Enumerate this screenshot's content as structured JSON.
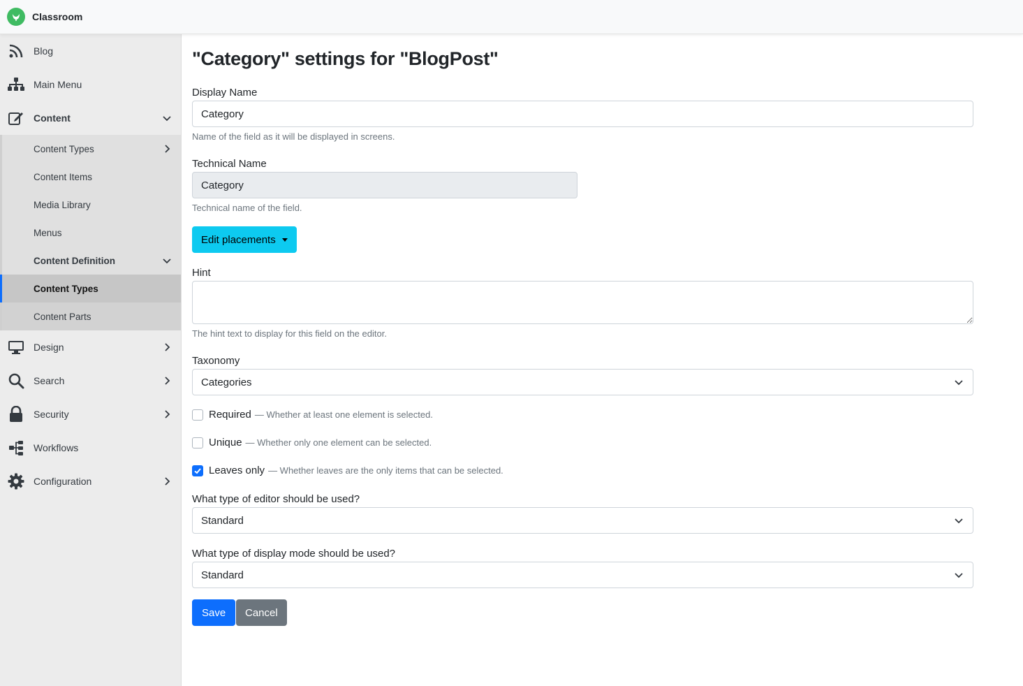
{
  "app": {
    "title": "Classroom"
  },
  "sidebar": {
    "items": [
      {
        "label": "Blog",
        "icon": "rss-icon"
      },
      {
        "label": "Main Menu",
        "icon": "sitemap-icon"
      },
      {
        "label": "Content",
        "icon": "edit-icon",
        "expanded": true
      },
      {
        "label": "Design",
        "icon": "desktop-icon"
      },
      {
        "label": "Search",
        "icon": "search-icon"
      },
      {
        "label": "Security",
        "icon": "lock-icon"
      },
      {
        "label": "Workflows",
        "icon": "workflow-icon"
      },
      {
        "label": "Configuration",
        "icon": "gear-icon"
      }
    ],
    "content_sub": {
      "content_types": "Content Types",
      "content_items": "Content Items",
      "media_library": "Media Library",
      "menus": "Menus",
      "content_definition": "Content Definition",
      "def_content_types": "Content Types",
      "def_content_parts": "Content Parts"
    }
  },
  "page": {
    "title": "\"Category\" settings for \"BlogPost\"",
    "display_name": {
      "label": "Display Name",
      "value": "Category",
      "help": "Name of the field as it will be displayed in screens."
    },
    "technical_name": {
      "label": "Technical Name",
      "value": "Category",
      "help": "Technical name of the field."
    },
    "edit_placements_label": "Edit placements",
    "hint": {
      "label": "Hint",
      "value": "",
      "help": "The hint text to display for this field on the editor."
    },
    "taxonomy": {
      "label": "Taxonomy",
      "selected": "Categories"
    },
    "required": {
      "label": "Required",
      "desc": "— Whether at least one element is selected.",
      "checked": false
    },
    "unique": {
      "label": "Unique",
      "desc": "— Whether only one element can be selected.",
      "checked": false
    },
    "leaves_only": {
      "label": "Leaves only",
      "desc": "— Whether leaves are the only items that can be selected.",
      "checked": true
    },
    "editor": {
      "label": "What type of editor should be used?",
      "selected": "Standard"
    },
    "display_mode": {
      "label": "What type of display mode should be used?",
      "selected": "Standard"
    },
    "save_label": "Save",
    "cancel_label": "Cancel"
  },
  "colors": {
    "accent": "#0d6efd",
    "info": "#0dcaf0",
    "secondary": "#6c757d",
    "brand": "#3fbb62"
  }
}
